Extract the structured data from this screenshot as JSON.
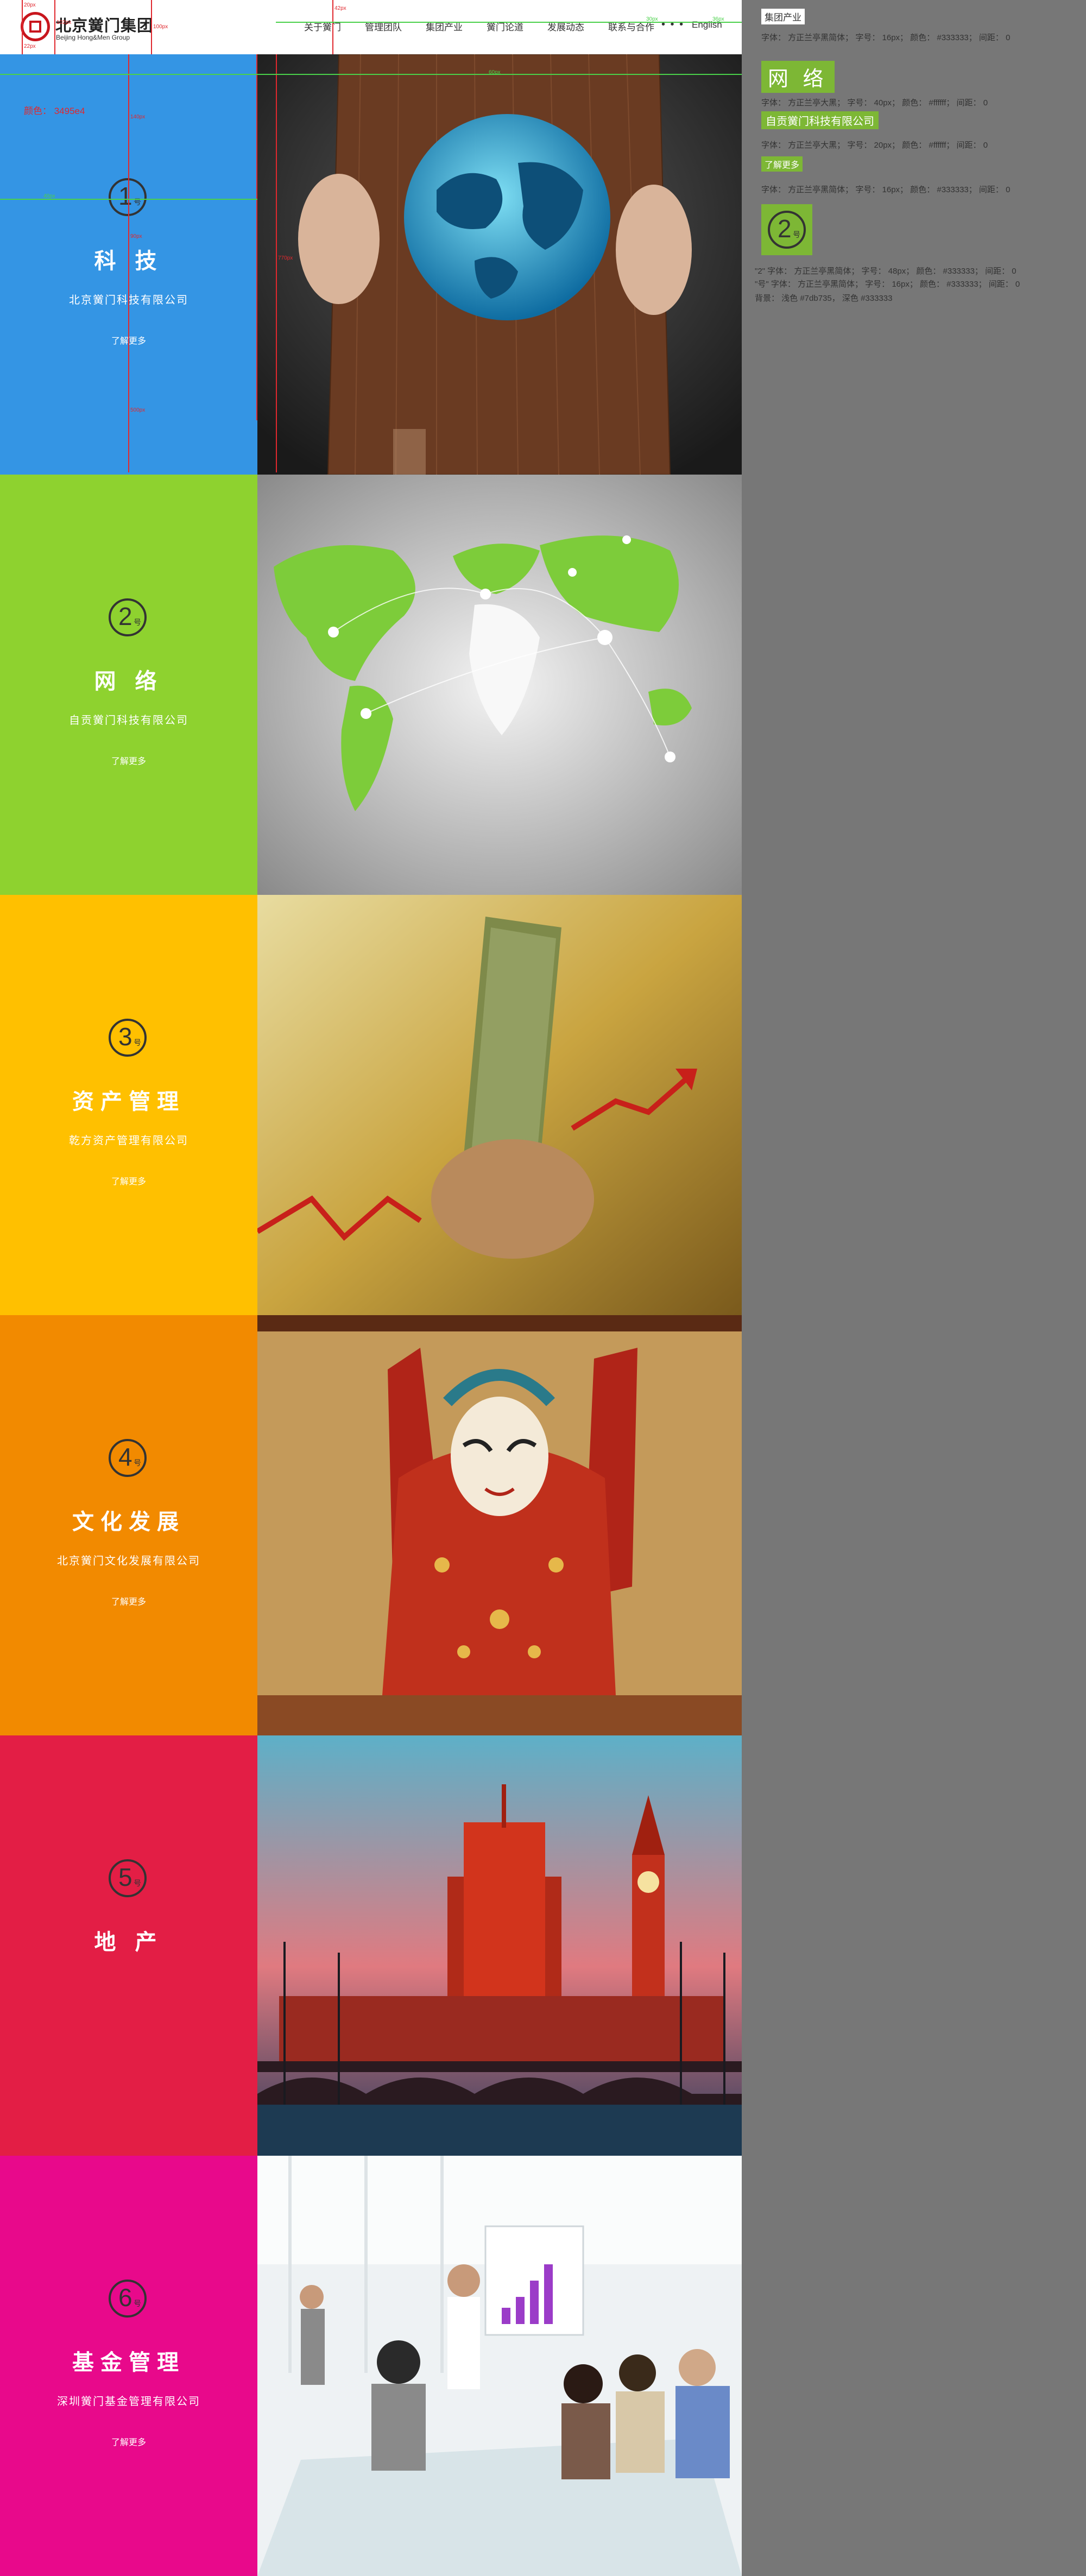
{
  "header": {
    "logo_cn": "北京黉门集团",
    "logo_en": "Beijing Hong&Men Group",
    "nav": [
      "关于黉门",
      "管理团队",
      "集团产业",
      "黉门论道",
      "发展动态",
      "联系与合作"
    ],
    "more_dots": "• • •",
    "lang": "English"
  },
  "guides": {
    "color_note": "颜色： 3495e4",
    "labels": [
      "20px",
      "42px",
      "100px",
      "102px",
      "22px",
      "30px",
      "36px",
      "60px",
      "15px",
      "140px",
      "90px",
      "500px",
      "40px",
      "770px"
    ]
  },
  "sections": [
    {
      "num": "1",
      "suffix": "号",
      "title": "科 技",
      "subtitle": "北京黉门科技有限公司",
      "more": "了解更多",
      "color": "#3495e4"
    },
    {
      "num": "2",
      "suffix": "号",
      "title": "网 络",
      "subtitle": "自贡黉门科技有限公司",
      "more": "了解更多",
      "color": "#8ed22f"
    },
    {
      "num": "3",
      "suffix": "号",
      "title": "资产管理",
      "subtitle": "乾方资产管理有限公司",
      "more": "了解更多",
      "color": "#ffc000"
    },
    {
      "num": "4",
      "suffix": "号",
      "title": "文化发展",
      "subtitle": "北京黉门文化发展有限公司",
      "more": "了解更多",
      "color": "#f28a00"
    },
    {
      "num": "5",
      "suffix": "号",
      "title": "地 产",
      "subtitle": "",
      "more": "",
      "color": "#e31e45"
    },
    {
      "num": "6",
      "suffix": "号",
      "title": "基金管理",
      "subtitle": "深圳黉门基金管理有限公司",
      "more": "了解更多",
      "color": "#e8098b"
    }
  ],
  "spec": {
    "tag": "集团产业",
    "line1": "字体： 方正兰亭黑简体； 字号： 16px； 颜色： #333333； 间距： 0",
    "title_sample": "网 络",
    "line2": "字体： 方正兰亭大黑； 字号： 40px； 颜色： #ffffff； 间距： 0",
    "sub_sample": "自贡黉门科技有限公司",
    "line3": "字体： 方正兰亭大黑； 字号： 20px； 颜色： #ffffff； 间距： 0",
    "more_sample": "了解更多",
    "line4": "字体： 方正兰亭黑简体； 字号： 16px； 颜色： #333333； 间距： 0",
    "circle_num": "2",
    "circle_suffix": "号",
    "line5": "\"2\" 字体： 方正兰亭黑简体； 字号： 48px； 颜色： #333333； 间距： 0",
    "line6": "\"号\" 字体： 方正兰亭黑简体； 字号： 16px； 颜色： #333333； 间距： 0",
    "line7": "背景： 浅色 #7db735， 深色 #333333"
  }
}
